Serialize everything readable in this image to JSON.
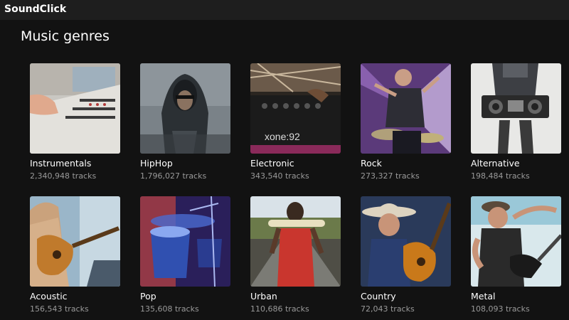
{
  "app": {
    "title": "SoundClick"
  },
  "section": {
    "title": "Music genres"
  },
  "genres": [
    {
      "name": "Instrumentals",
      "tracks": "2,340,948 tracks",
      "image": "mixing-console"
    },
    {
      "name": "HipHop",
      "tracks": "1,796,027 tracks",
      "image": "hooded-man"
    },
    {
      "name": "Electronic",
      "tracks": "343,540 tracks",
      "image": "dj-mixer"
    },
    {
      "name": "Rock",
      "tracks": "273,327 tracks",
      "image": "drummer"
    },
    {
      "name": "Alternative",
      "tracks": "198,484 tracks",
      "image": "boombox"
    },
    {
      "name": "Acoustic",
      "tracks": "156,543 tracks",
      "image": "acoustic-guitarist"
    },
    {
      "name": "Pop",
      "tracks": "135,608 tracks",
      "image": "drum-kit"
    },
    {
      "name": "Urban",
      "tracks": "110,686 tracks",
      "image": "man-on-road"
    },
    {
      "name": "Country",
      "tracks": "72,043 tracks",
      "image": "cowboy-guitarist"
    },
    {
      "name": "Metal",
      "tracks": "108,093 tracks",
      "image": "metal-guitarist"
    }
  ]
}
